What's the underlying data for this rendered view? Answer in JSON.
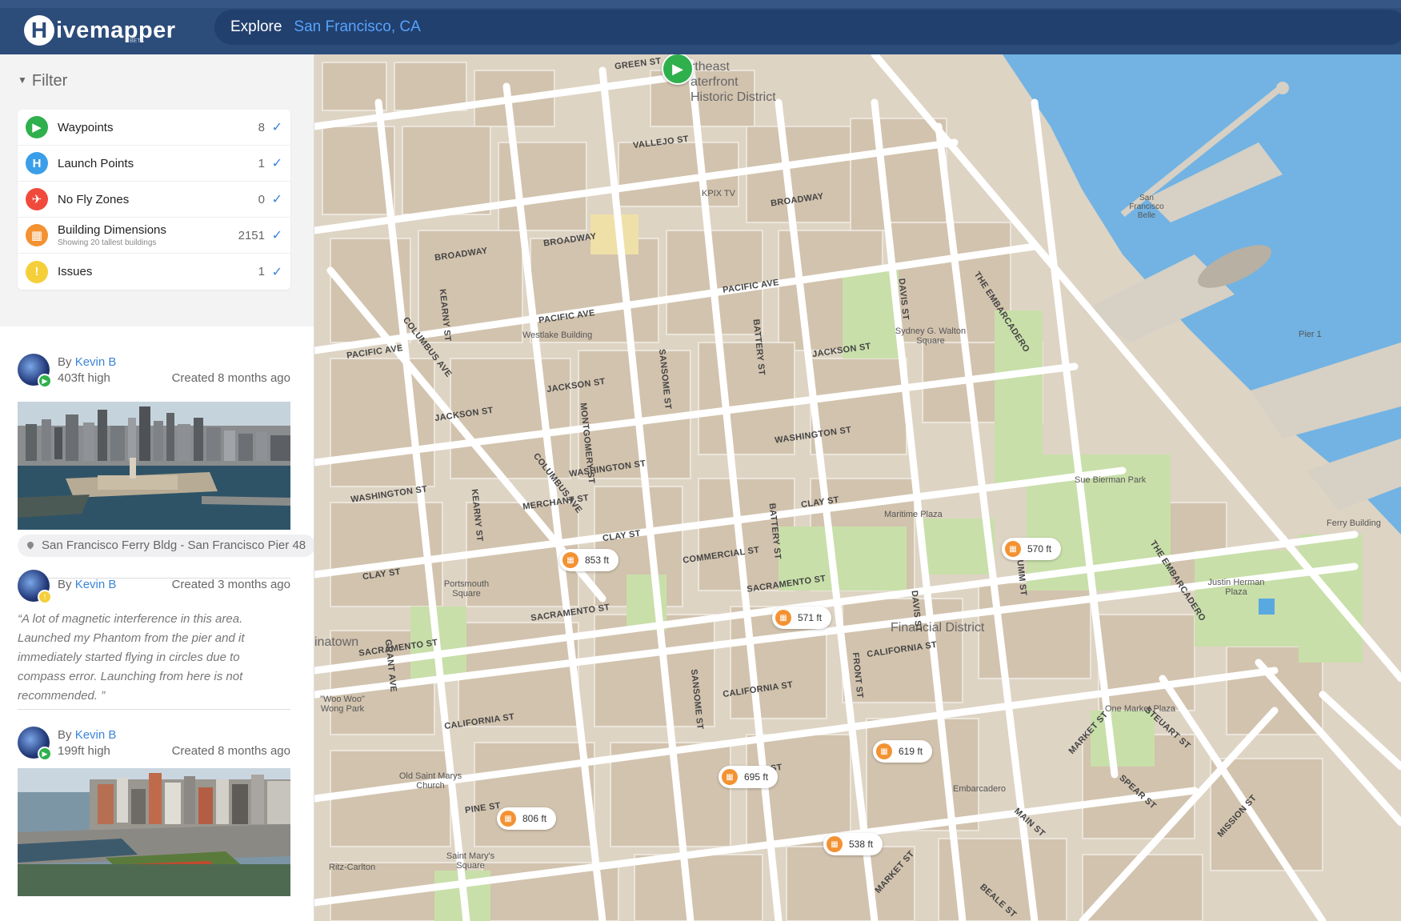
{
  "header": {
    "logo_letter": "H",
    "logo_text": "ivemapper",
    "logo_beta": "BETA",
    "explore_label": "Explore",
    "location_value": "San Francisco, CA"
  },
  "filter": {
    "title": "Filter",
    "items": [
      {
        "label": "Waypoints",
        "count": "8",
        "icon": "flag-icon",
        "color": "#2fb04d",
        "glyph": "▶"
      },
      {
        "label": "Launch Points",
        "count": "1",
        "icon": "helipad-icon",
        "color": "#3b9ee8",
        "glyph": "H"
      },
      {
        "label": "No Fly Zones",
        "count": "0",
        "icon": "airplane-icon",
        "color": "#f04a3c",
        "glyph": "✈"
      },
      {
        "label": "Building Dimensions",
        "sublabel": "Showing 20 tallest buildings",
        "count": "2151",
        "icon": "building-icon",
        "color": "#f39232",
        "glyph": "▦"
      },
      {
        "label": "Issues",
        "count": "1",
        "icon": "warning-icon",
        "color": "#f5cf3a",
        "glyph": "!"
      }
    ]
  },
  "feed": {
    "posts": [
      {
        "by_prefix": "By",
        "author": "Kevin B",
        "height": "403ft high",
        "created": "Created 8 months ago",
        "badge_color": "#2fb04d",
        "location": "San Francisco Ferry Bldg - San Francisco Pier 48"
      },
      {
        "by_prefix": "By",
        "author": "Kevin B",
        "created": "Created 3 months ago",
        "badge_color": "#f5cf3a",
        "quote": "“A lot of magnetic interference in this area. Launched my Phantom from the pier and it immediately started flying in circles due to compass error. Launching from here is not recommended. ”"
      },
      {
        "by_prefix": "By",
        "author": "Kevin B",
        "height": "199ft high",
        "created": "Created 8 months ago",
        "badge_color": "#2fb04d"
      }
    ]
  },
  "map": {
    "districts": [
      {
        "name": "Northeast Waterfront Historic District",
        "line1": "rtheast",
        "line2": "aterfront",
        "line3": "Historic District"
      },
      {
        "name": "Financial District",
        "text": "Financial District"
      }
    ],
    "places": [
      "Westlake Building",
      "KPIX TV",
      "Sydney G. Walton Square",
      "Maritime Plaza",
      "Sue Bierman Park",
      "Justin Herman Plaza",
      "Portsmouth Square",
      "Old Saint Marys Church",
      "Saint Mary's Square",
      "Ritz-Carlton",
      "One Market Plaza",
      "Embarcadero",
      "Ferry Building",
      "Pier 1",
      "San Francisco Belle",
      "inatown",
      "\"Woo Woo\" Wong Park"
    ],
    "streets": [
      "GREEN ST",
      "VALLEJO ST",
      "BROADWAY",
      "PACIFIC AVE",
      "JACKSON ST",
      "WASHINGTON ST",
      "CLAY ST",
      "COMMERCIAL ST",
      "SACRAMENTO ST",
      "CALIFORNIA ST",
      "PINE ST",
      "MERCHANT ST",
      "COLUMBUS AVE",
      "KEARNY ST",
      "MONTGOMERY ST",
      "SANSOME ST",
      "BATTERY ST",
      "FRONT ST",
      "DAVIS ST",
      "DRUMM ST",
      "THE EMBARCADERO",
      "MARKET ST",
      "MAIN ST",
      "SPEAR ST",
      "STEUART ST",
      "MISSION ST",
      "BEALE ST",
      "GRANT AVE"
    ],
    "building_tags": [
      "853 ft",
      "570 ft",
      "571 ft",
      "619 ft",
      "695 ft",
      "806 ft",
      "538 ft"
    ]
  }
}
